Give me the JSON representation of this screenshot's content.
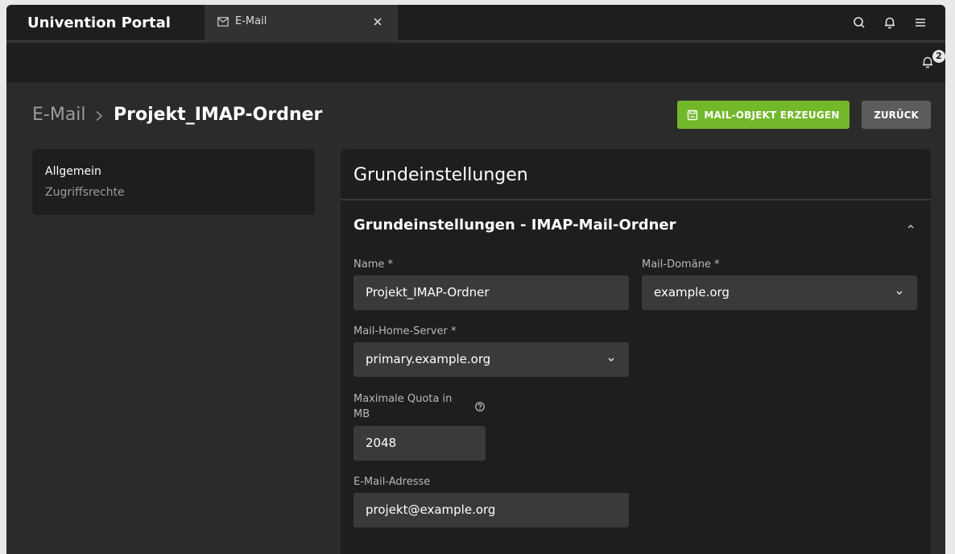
{
  "header": {
    "portal_title": "Univention Portal",
    "tab_label": "E-Mail"
  },
  "notifications": {
    "count": "2"
  },
  "breadcrumb": {
    "parent": "E-Mail",
    "current": "Projekt_IMAP-Ordner"
  },
  "actions": {
    "create_label": "MAIL-OBJEKT ERZEUGEN",
    "back_label": "ZURÜCK"
  },
  "sidenav": {
    "items": [
      "Allgemein",
      "Zugriffsrechte"
    ]
  },
  "panel": {
    "title": "Grundeinstellungen",
    "section_title": "Grundeinstellungen - IMAP-Mail-Ordner",
    "fields": {
      "name": {
        "label": "Name *",
        "value": "Projekt_IMAP-Ordner"
      },
      "domain": {
        "label": "Mail-Domäne *",
        "value": "example.org"
      },
      "home_server": {
        "label": "Mail-Home-Server *",
        "value": "primary.example.org"
      },
      "quota": {
        "label_line1": "Maximale Quota in",
        "label_line2": "MB",
        "value": "2048"
      },
      "email": {
        "label": "E-Mail-Adresse",
        "value": "projekt@example.org"
      }
    }
  },
  "colors": {
    "accent": "#73b82b",
    "background": "#2b2b2b",
    "surface": "#1e1e1e",
    "input": "#3a3a3a"
  },
  "icons": [
    "mail-icon",
    "close-icon",
    "search-icon",
    "bell-icon",
    "menu-icon",
    "save-icon",
    "chevron-right-icon",
    "chevron-up-icon",
    "chevron-down-icon",
    "help-icon"
  ]
}
